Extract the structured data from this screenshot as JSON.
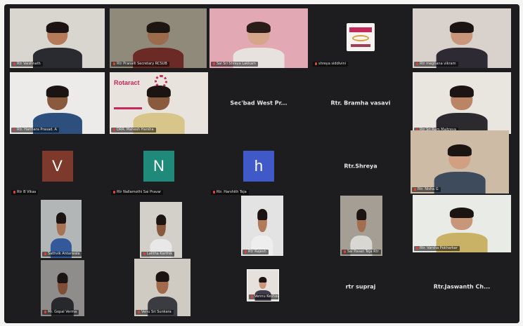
{
  "meeting": {
    "grid_background": "#1d1d20",
    "tiles": [
      {
        "id": "t1",
        "type": "video",
        "name": "Rtr Vaishnath",
        "skin": "#b57a58",
        "hair": "#1b1412",
        "shirt": "#2a2b30",
        "bg": "#d9d6d0"
      },
      {
        "id": "t2",
        "type": "video",
        "name": "Rtr Pranalli Secretary RCSUB",
        "skin": "#9c6a4c",
        "hair": "#1c1512",
        "shirt": "#6b2a25",
        "bg": "#8f8a7a"
      },
      {
        "id": "t3",
        "type": "video",
        "name": "Sai Sri Shreya Lakkam",
        "skin": "#d6a58a",
        "hair": "#2a1c18",
        "shirt": "#e8e2df",
        "bg": "#e2a8b4"
      },
      {
        "id": "t4",
        "type": "logo",
        "name": "shreya siddivini"
      },
      {
        "id": "t5",
        "type": "video",
        "name": "Rtr meghana vikram",
        "skin": "#c99679",
        "hair": "#1b1412",
        "shirt": "#2e2a34",
        "bg": "#d9d2cc"
      },
      {
        "id": "t6",
        "type": "video",
        "name": "Rtr. Harihara Prasad. A",
        "skin": "#8a5a3e",
        "hair": "#1b1412",
        "shirt": "#2d4f7d",
        "bg": "#ecebe9"
      },
      {
        "id": "t7",
        "type": "banner",
        "name": "DRR. Mahesh Harsha",
        "banner_word": "Rotaract",
        "skin": "#8a5a3e",
        "hair": "#1b1412",
        "shirt": "#d8c58a",
        "bg": "#e8e3dc"
      },
      {
        "id": "t8",
        "type": "name",
        "display": "Sec'bad West Pr..."
      },
      {
        "id": "t9",
        "type": "name",
        "display": "Rtr. Bramha vasavi"
      },
      {
        "id": "t10",
        "type": "video",
        "name": "Rtr Sri Ram Maitreya",
        "skin": "#b98564",
        "hair": "#1b1412",
        "shirt": "#2b2a2f",
        "bg": "#e9e6e0"
      },
      {
        "id": "t11",
        "type": "avatar",
        "letter": "V",
        "color": "#7d3a2c",
        "name": "Rtr B Vikas"
      },
      {
        "id": "t12",
        "type": "avatar",
        "letter": "N",
        "color": "#1f8a7a",
        "name": "Rtr Nallamothi Sai Pravar"
      },
      {
        "id": "t13",
        "type": "avatar",
        "letter": "h",
        "color": "#3f59c9",
        "name": "Rtr. Harshith Teja"
      },
      {
        "id": "t14",
        "type": "name",
        "display": "Rtr.Shreya"
      },
      {
        "id": "t15",
        "type": "video",
        "name": "Rtr. Nisha G",
        "skin": "#d1a083",
        "hair": "#1b1412",
        "shirt": "#3d4b5c",
        "bg": "#cdbba6"
      },
      {
        "id": "t16",
        "type": "video",
        "name": "Sathvik Antarwala",
        "skin": "#a87355",
        "hair": "#1b1412",
        "shirt": "#33599a",
        "bg": "#b3b6b7"
      },
      {
        "id": "t17",
        "type": "video",
        "name": "Lalitha Karthik",
        "skin": "#8a5a3e",
        "hair": "#1b1412",
        "shirt": "#e8e8e8",
        "bg": "#d3cfc9"
      },
      {
        "id": "t18",
        "type": "video",
        "name": "Rtr Rajesh",
        "skin": "#b07a5b",
        "hair": "#1b1412",
        "shirt": "#edeeed",
        "bg": "#e3e3e3"
      },
      {
        "id": "t19",
        "type": "video",
        "name": "Sai Pavan Teja Rtr",
        "skin": "#a36d50",
        "hair": "#1b1412",
        "shirt": "#d9d7d3",
        "bg": "#a49e94"
      },
      {
        "id": "t20",
        "type": "video",
        "name": "Rtr. Varsha Pokharkar",
        "skin": "#c89678",
        "hair": "#1b1412",
        "shirt": "#c9b266",
        "bg": "#e8ebe6"
      },
      {
        "id": "t21",
        "type": "video",
        "name": "Mr. Gopal Verma",
        "skin": "#7e4f36",
        "hair": "#1b1412",
        "shirt": "#27282c",
        "bg": "#8f8d8b"
      },
      {
        "id": "t22",
        "type": "video",
        "name": "Venu Sri Sunkara",
        "skin": "#a06a4c",
        "hair": "#1b1412",
        "shirt": "#3a3c42",
        "bg": "#cfcac2"
      },
      {
        "id": "t23",
        "type": "photo",
        "name": "Vennu Keshava Reddy",
        "skin": "#c99679",
        "hair": "#1b1412",
        "shirt": "#403a4a",
        "bg": "#e6e1dd"
      },
      {
        "id": "t24",
        "type": "name",
        "display": "rtr supraj"
      },
      {
        "id": "t25",
        "type": "name",
        "display": "Rtr.Jaswanth Ch..."
      }
    ]
  }
}
